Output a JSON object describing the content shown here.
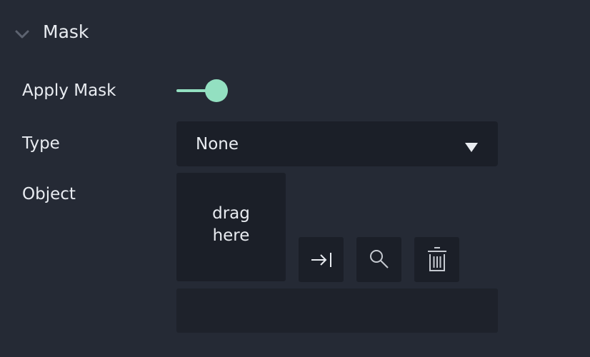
{
  "section": {
    "title": "Mask"
  },
  "apply_mask": {
    "label": "Apply Mask",
    "enabled": true
  },
  "type": {
    "label": "Type",
    "selected": "None"
  },
  "object": {
    "label": "Object",
    "drop_zone_text": "drag here",
    "field_value": ""
  },
  "colors": {
    "background": "#252a35",
    "field_background": "#1b1f28",
    "toggle_accent": "#93e0c1",
    "text": "#e9ecf1"
  },
  "icons": {
    "collapse": "chevron-down-icon",
    "select": "select-icon",
    "locate": "search-icon",
    "delete": "trash-icon",
    "dropdown": "dropdown-arrow-icon"
  }
}
